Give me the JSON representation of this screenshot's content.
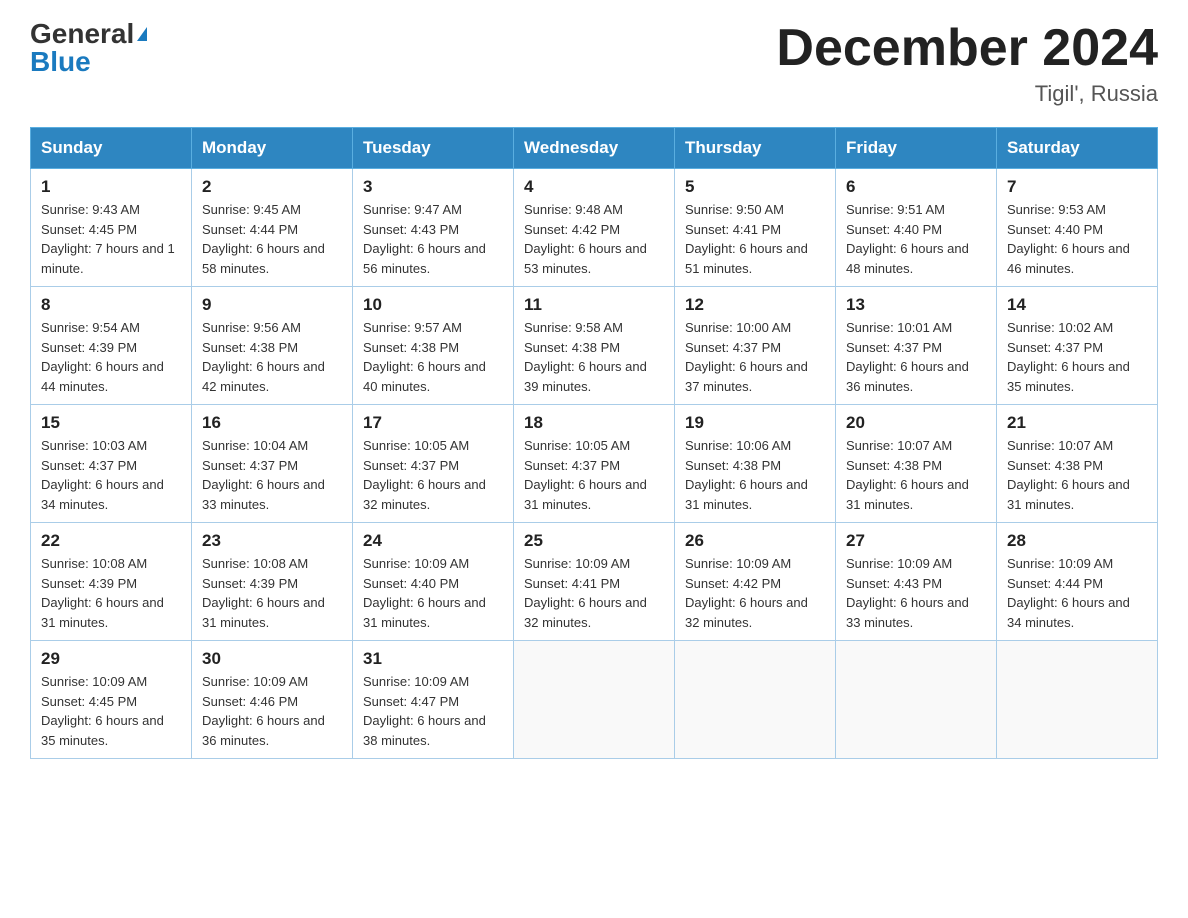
{
  "header": {
    "logo_general": "General",
    "logo_blue": "Blue",
    "month_title": "December 2024",
    "location": "Tigil', Russia"
  },
  "days_of_week": [
    "Sunday",
    "Monday",
    "Tuesday",
    "Wednesday",
    "Thursday",
    "Friday",
    "Saturday"
  ],
  "weeks": [
    [
      {
        "day": "1",
        "sunrise": "9:43 AM",
        "sunset": "4:45 PM",
        "daylight": "7 hours and 1 minute."
      },
      {
        "day": "2",
        "sunrise": "9:45 AM",
        "sunset": "4:44 PM",
        "daylight": "6 hours and 58 minutes."
      },
      {
        "day": "3",
        "sunrise": "9:47 AM",
        "sunset": "4:43 PM",
        "daylight": "6 hours and 56 minutes."
      },
      {
        "day": "4",
        "sunrise": "9:48 AM",
        "sunset": "4:42 PM",
        "daylight": "6 hours and 53 minutes."
      },
      {
        "day": "5",
        "sunrise": "9:50 AM",
        "sunset": "4:41 PM",
        "daylight": "6 hours and 51 minutes."
      },
      {
        "day": "6",
        "sunrise": "9:51 AM",
        "sunset": "4:40 PM",
        "daylight": "6 hours and 48 minutes."
      },
      {
        "day": "7",
        "sunrise": "9:53 AM",
        "sunset": "4:40 PM",
        "daylight": "6 hours and 46 minutes."
      }
    ],
    [
      {
        "day": "8",
        "sunrise": "9:54 AM",
        "sunset": "4:39 PM",
        "daylight": "6 hours and 44 minutes."
      },
      {
        "day": "9",
        "sunrise": "9:56 AM",
        "sunset": "4:38 PM",
        "daylight": "6 hours and 42 minutes."
      },
      {
        "day": "10",
        "sunrise": "9:57 AM",
        "sunset": "4:38 PM",
        "daylight": "6 hours and 40 minutes."
      },
      {
        "day": "11",
        "sunrise": "9:58 AM",
        "sunset": "4:38 PM",
        "daylight": "6 hours and 39 minutes."
      },
      {
        "day": "12",
        "sunrise": "10:00 AM",
        "sunset": "4:37 PM",
        "daylight": "6 hours and 37 minutes."
      },
      {
        "day": "13",
        "sunrise": "10:01 AM",
        "sunset": "4:37 PM",
        "daylight": "6 hours and 36 minutes."
      },
      {
        "day": "14",
        "sunrise": "10:02 AM",
        "sunset": "4:37 PM",
        "daylight": "6 hours and 35 minutes."
      }
    ],
    [
      {
        "day": "15",
        "sunrise": "10:03 AM",
        "sunset": "4:37 PM",
        "daylight": "6 hours and 34 minutes."
      },
      {
        "day": "16",
        "sunrise": "10:04 AM",
        "sunset": "4:37 PM",
        "daylight": "6 hours and 33 minutes."
      },
      {
        "day": "17",
        "sunrise": "10:05 AM",
        "sunset": "4:37 PM",
        "daylight": "6 hours and 32 minutes."
      },
      {
        "day": "18",
        "sunrise": "10:05 AM",
        "sunset": "4:37 PM",
        "daylight": "6 hours and 31 minutes."
      },
      {
        "day": "19",
        "sunrise": "10:06 AM",
        "sunset": "4:38 PM",
        "daylight": "6 hours and 31 minutes."
      },
      {
        "day": "20",
        "sunrise": "10:07 AM",
        "sunset": "4:38 PM",
        "daylight": "6 hours and 31 minutes."
      },
      {
        "day": "21",
        "sunrise": "10:07 AM",
        "sunset": "4:38 PM",
        "daylight": "6 hours and 31 minutes."
      }
    ],
    [
      {
        "day": "22",
        "sunrise": "10:08 AM",
        "sunset": "4:39 PM",
        "daylight": "6 hours and 31 minutes."
      },
      {
        "day": "23",
        "sunrise": "10:08 AM",
        "sunset": "4:39 PM",
        "daylight": "6 hours and 31 minutes."
      },
      {
        "day": "24",
        "sunrise": "10:09 AM",
        "sunset": "4:40 PM",
        "daylight": "6 hours and 31 minutes."
      },
      {
        "day": "25",
        "sunrise": "10:09 AM",
        "sunset": "4:41 PM",
        "daylight": "6 hours and 32 minutes."
      },
      {
        "day": "26",
        "sunrise": "10:09 AM",
        "sunset": "4:42 PM",
        "daylight": "6 hours and 32 minutes."
      },
      {
        "day": "27",
        "sunrise": "10:09 AM",
        "sunset": "4:43 PM",
        "daylight": "6 hours and 33 minutes."
      },
      {
        "day": "28",
        "sunrise": "10:09 AM",
        "sunset": "4:44 PM",
        "daylight": "6 hours and 34 minutes."
      }
    ],
    [
      {
        "day": "29",
        "sunrise": "10:09 AM",
        "sunset": "4:45 PM",
        "daylight": "6 hours and 35 minutes."
      },
      {
        "day": "30",
        "sunrise": "10:09 AM",
        "sunset": "4:46 PM",
        "daylight": "6 hours and 36 minutes."
      },
      {
        "day": "31",
        "sunrise": "10:09 AM",
        "sunset": "4:47 PM",
        "daylight": "6 hours and 38 minutes."
      },
      null,
      null,
      null,
      null
    ]
  ]
}
